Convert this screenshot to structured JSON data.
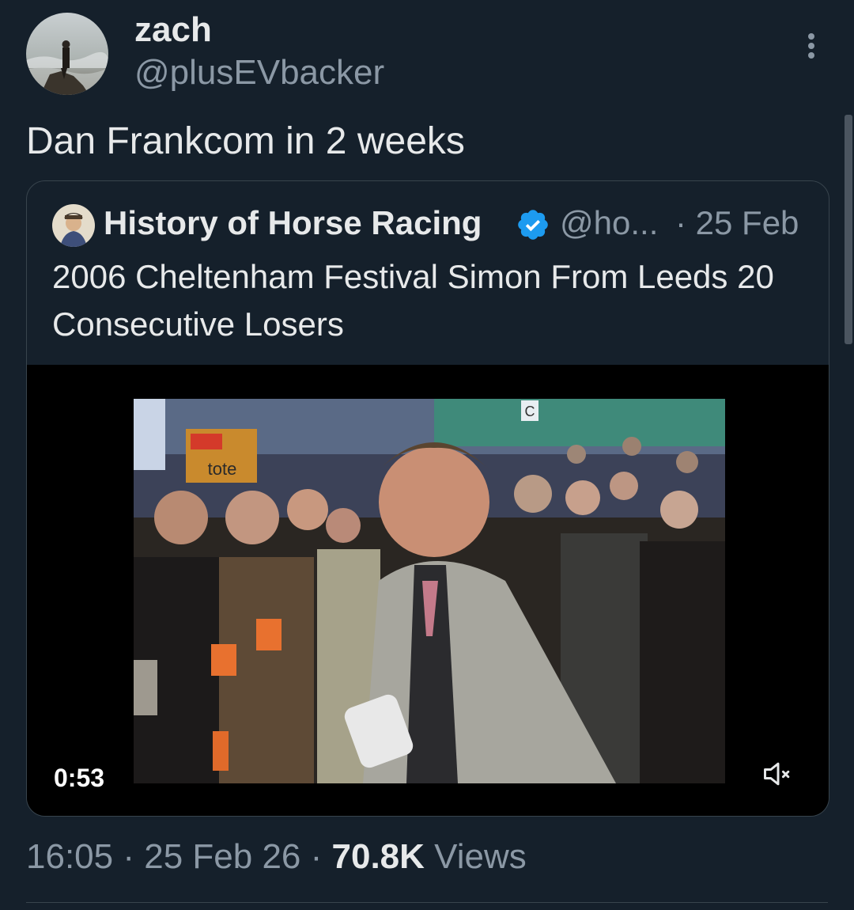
{
  "tweet": {
    "author": {
      "display_name": "zach",
      "handle": "@plusEVbacker"
    },
    "text": "Dan Frankcom in 2 weeks",
    "meta": {
      "time": "16:05",
      "separator": "·",
      "date": "25 Feb 26",
      "views_count": "70.8K",
      "views_label": "Views"
    }
  },
  "quote": {
    "display_name": "History of Horse Racing",
    "handle": "@ho...",
    "date": "· 25 Feb",
    "text": "2006 Cheltenham Festival Simon From Leeds 20 Consecutive Losers",
    "video": {
      "duration": "0:53",
      "sign_text": "tote",
      "badge_letter": "C"
    }
  },
  "icons": {
    "verified": "verified-badge-icon",
    "more": "more-options-icon",
    "mute": "speaker-muted-icon"
  },
  "colors": {
    "background": "#15202b",
    "verified": "#1d9bf0",
    "secondary_text": "#8b98a5"
  }
}
